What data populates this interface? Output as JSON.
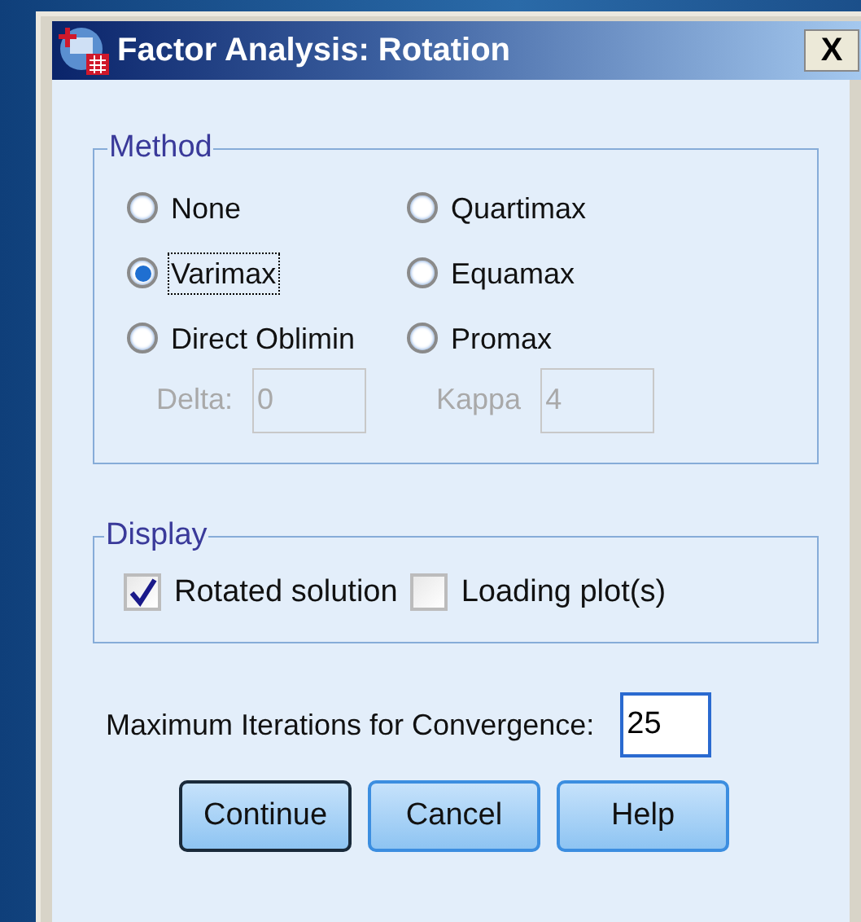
{
  "window": {
    "title": "Factor Analysis: Rotation",
    "close_label": "X"
  },
  "method": {
    "title": "Method",
    "options": [
      {
        "label": "None",
        "selected": false,
        "focused": false
      },
      {
        "label": "Quartimax",
        "selected": false,
        "focused": false
      },
      {
        "label": "Varimax",
        "selected": true,
        "focused": true
      },
      {
        "label": "Equamax",
        "selected": false,
        "focused": false
      },
      {
        "label": "Direct Oblimin",
        "selected": false,
        "focused": false
      },
      {
        "label": "Promax",
        "selected": false,
        "focused": false
      }
    ],
    "params": [
      {
        "label": "Delta:",
        "value": "0",
        "disabled": true
      },
      {
        "label": "Kappa",
        "value": "4",
        "disabled": true
      }
    ]
  },
  "display": {
    "title": "Display",
    "options": [
      {
        "label": "Rotated solution",
        "checked": true
      },
      {
        "label": "Loading plot(s)",
        "checked": false
      }
    ]
  },
  "iterations": {
    "label": "Maximum Iterations for Convergence:",
    "value": "25"
  },
  "buttons": [
    {
      "label": "Continue",
      "default": true
    },
    {
      "label": "Cancel",
      "default": false
    },
    {
      "label": "Help",
      "default": false
    }
  ]
}
